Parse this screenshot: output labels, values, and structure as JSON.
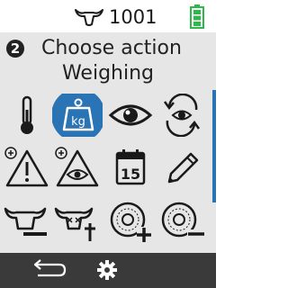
{
  "status": {
    "animal_icon": "cow-head-icon",
    "animal_id": "1001",
    "battery_icon": "battery-full-icon",
    "battery_color": "#2fb84a"
  },
  "header": {
    "step": "2",
    "title": "Choose action",
    "subtitle": "Weighing"
  },
  "actions": [
    {
      "icon": "thermometer-icon",
      "label": ""
    },
    {
      "icon": "weighing-kg-icon",
      "label": "kg",
      "selected": true
    },
    {
      "icon": "eye-icon",
      "label": ""
    },
    {
      "icon": "eye-cycle-icon",
      "label": ""
    },
    {
      "icon": "warning-add-icon",
      "label": ""
    },
    {
      "icon": "observation-add-icon",
      "label": ""
    },
    {
      "icon": "calendar-icon",
      "label": "15"
    },
    {
      "icon": "pencil-icon",
      "label": ""
    },
    {
      "icon": "remove-animal-icon",
      "label": ""
    },
    {
      "icon": "animal-death-icon",
      "label": ""
    },
    {
      "icon": "tag-add-icon",
      "label": ""
    },
    {
      "icon": "tag-remove-icon",
      "label": ""
    }
  ],
  "toolbar": {
    "back_icon": "back-arrow-icon",
    "settings_icon": "gear-icon"
  },
  "colors": {
    "accent": "#2a73b4",
    "panel": "#e6e6e6",
    "toolbar": "#3a3a3a"
  }
}
